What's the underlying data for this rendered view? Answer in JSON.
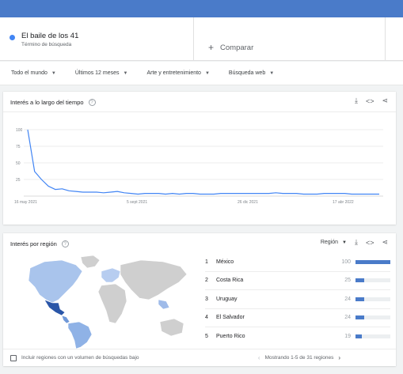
{
  "search_term": {
    "name": "El baile de los 41",
    "subtitle": "Término de búsqueda",
    "color": "#4285f4"
  },
  "compare": {
    "plus": "+",
    "label": "Comparar"
  },
  "filters": [
    {
      "label": "Todo el mundo"
    },
    {
      "label": "Últimos 12 meses"
    },
    {
      "label": "Arte y entretenimiento"
    },
    {
      "label": "Búsqueda web"
    }
  ],
  "interest_over_time": {
    "title": "Interés a lo largo del tiempo",
    "help": "?",
    "actions": {
      "download": "⤓",
      "embed": "<>",
      "share": "⋖"
    }
  },
  "interest_by_region": {
    "title": "Interés por región",
    "help": "?",
    "region_label": "Región",
    "actions": {
      "download": "⤓",
      "embed": "<>",
      "share": "⋖"
    },
    "rows": [
      {
        "rank": "1",
        "name": "México",
        "value": "100",
        "level": 100
      },
      {
        "rank": "2",
        "name": "Costa Rica",
        "value": "25",
        "level": 25
      },
      {
        "rank": "3",
        "name": "Uruguay",
        "value": "24",
        "level": 24
      },
      {
        "rank": "4",
        "name": "El Salvador",
        "value": "24",
        "level": 24
      },
      {
        "rank": "5",
        "name": "Puerto Rico",
        "value": "19",
        "level": 19
      }
    ],
    "footer_checkbox_label": "Incluir regiones con un volumen de búsquedas bajo",
    "pager_label": "Mostrando 1-5 de 31 regiones",
    "pager_prev": "‹",
    "pager_next": "›"
  },
  "chart_data": {
    "type": "line",
    "title": "",
    "xlabel": "",
    "ylabel": "",
    "ylim": [
      0,
      100
    ],
    "yticks": [
      "100",
      "75",
      "50",
      "25"
    ],
    "xticks": [
      "16 may 2021",
      "5 sept 2021",
      "26 dic 2021",
      "17 abr 2022"
    ],
    "grid": true,
    "series": [
      {
        "color": "#4285f4",
        "values": [
          100,
          37,
          25,
          15,
          10,
          11,
          8,
          7,
          6,
          6,
          6,
          5,
          6,
          7,
          5,
          4,
          3,
          4,
          4,
          4,
          3,
          4,
          3,
          4,
          4,
          3,
          3,
          3,
          4,
          4,
          4,
          4,
          4,
          4,
          4,
          4,
          5,
          4,
          4,
          4,
          3,
          3,
          3,
          4,
          4,
          4,
          4,
          3,
          3,
          3,
          3,
          3
        ]
      }
    ]
  }
}
